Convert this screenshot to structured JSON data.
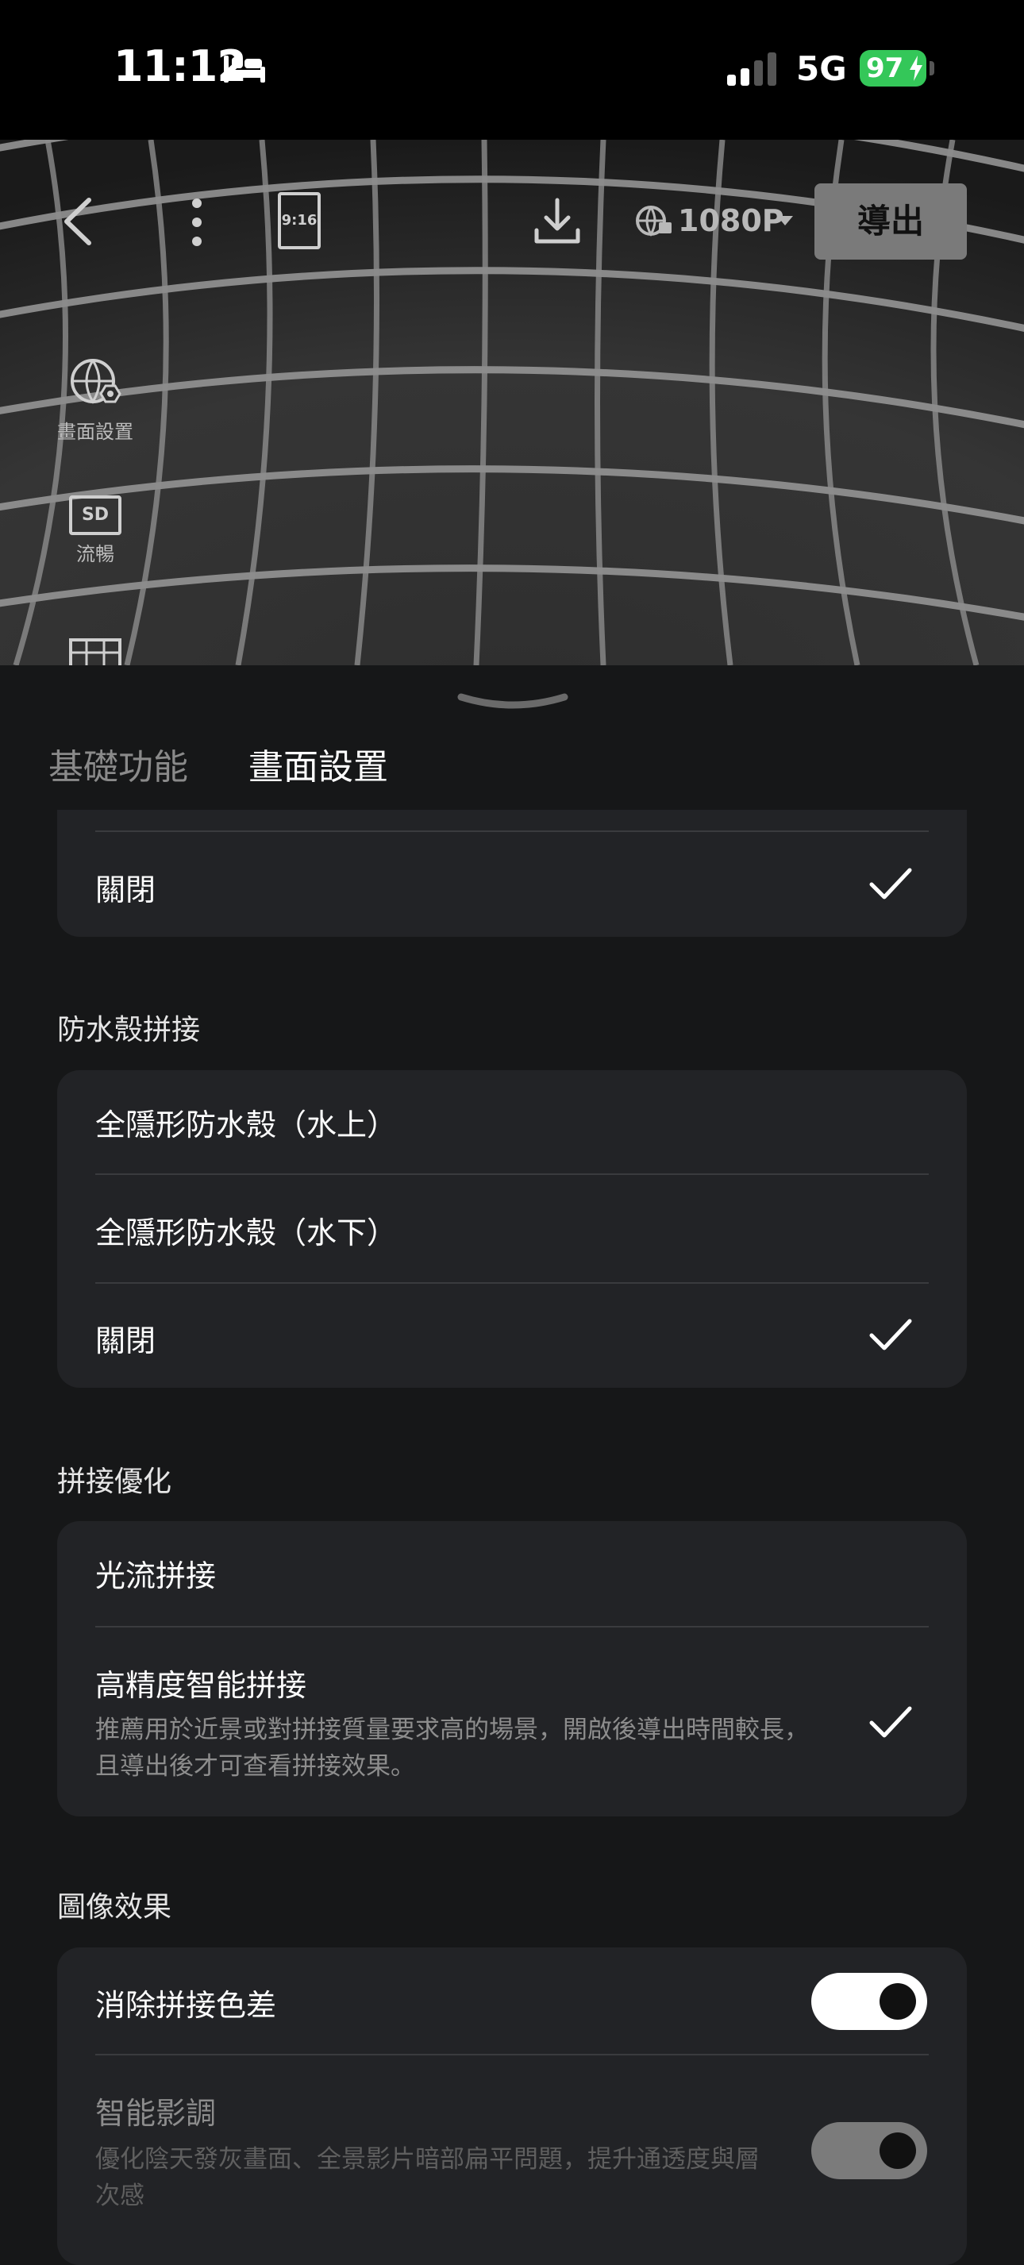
{
  "status": {
    "time": "11:12",
    "network": "5G",
    "battery": "97"
  },
  "toolbar": {
    "aspect_ratio": "9:16",
    "resolution": "1080P",
    "export_label": "導出"
  },
  "side_tools": [
    {
      "label": "畫面設置",
      "icon": "globe-gear-icon"
    },
    {
      "label": "流暢",
      "icon": "sd-badge-icon"
    }
  ],
  "tabs": {
    "basic": "基礎功能",
    "display": "畫面設置"
  },
  "top_card": {
    "off_label": "關閉"
  },
  "waterproof": {
    "title": "防水殼拼接",
    "options": [
      {
        "label": "全隱形防水殼（水上）",
        "selected": false
      },
      {
        "label": "全隱形防水殼（水下）",
        "selected": false
      },
      {
        "label": "關閉",
        "selected": true
      }
    ]
  },
  "stitch": {
    "title": "拼接優化",
    "options": [
      {
        "label": "光流拼接",
        "selected": false
      },
      {
        "label": "高精度智能拼接",
        "desc": "推薦用於近景或對拼接質量要求高的場景，開啟後導出時間較長，且導出後才可查看拼接效果。",
        "selected": true
      }
    ]
  },
  "image_effect": {
    "title": "圖像效果",
    "items": [
      {
        "label": "消除拼接色差",
        "enabled": true
      },
      {
        "label": "智能影調",
        "desc": "優化陰天發灰畫面、全景影片暗部扁平問題，提升通透度與層次感",
        "enabled": true,
        "disabled_style": true
      }
    ]
  },
  "colors": {
    "accent_battery": "#34c759",
    "card_bg": "#222326",
    "sheet_bg": "#161718"
  }
}
